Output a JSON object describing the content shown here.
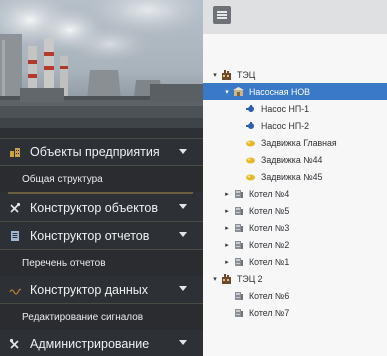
{
  "sidebar": {
    "menu": [
      {
        "label": "Объекты предприятия",
        "icon": "buildings-icon",
        "has_children": true
      },
      {
        "label": "Общая структура",
        "sub": true
      },
      {
        "label": "Конструктор объектов",
        "icon": "tools-icon",
        "has_children": true
      },
      {
        "label": "Конструктор отчетов",
        "icon": "report-icon",
        "has_children": true
      },
      {
        "label": "Перечень отчетов",
        "sub": true
      },
      {
        "label": "Конструктор данных",
        "icon": "data-wave-icon",
        "has_children": true
      },
      {
        "label": "Редактирование сигналов",
        "sub": true
      },
      {
        "label": "Администрирование",
        "icon": "admin-tools-icon",
        "has_children": true
      }
    ]
  },
  "topbar": {
    "menu_icon": "hamburger-icon"
  },
  "tree": {
    "nodes": [
      {
        "label": "ТЭЦ",
        "toggle": "▾",
        "icon": "plant-icon",
        "level": 0
      },
      {
        "label": "Насосная НОВ",
        "toggle": "▾",
        "icon": "pump-station-icon",
        "level": 1,
        "selected": true
      },
      {
        "label": "Насос НП-1",
        "toggle": "",
        "icon": "pump-icon",
        "level": 2
      },
      {
        "label": "Насос НП-2",
        "toggle": "",
        "icon": "pump-icon",
        "level": 2
      },
      {
        "label": "Задвижка Главная",
        "toggle": "",
        "icon": "valve-icon",
        "level": 2
      },
      {
        "label": "Задвижка №44",
        "toggle": "",
        "icon": "valve-icon",
        "level": 2
      },
      {
        "label": "Задвижка №45",
        "toggle": "",
        "icon": "valve-icon",
        "level": 2
      },
      {
        "label": "Котел №4",
        "toggle": "▸",
        "icon": "boiler-icon",
        "level": 1
      },
      {
        "label": "Котел №5",
        "toggle": "▸",
        "icon": "boiler-icon",
        "level": 1
      },
      {
        "label": "Котел №3",
        "toggle": "▸",
        "icon": "boiler-icon",
        "level": 1
      },
      {
        "label": "Котел №2",
        "toggle": "▸",
        "icon": "boiler-icon",
        "level": 1
      },
      {
        "label": "Котел №1",
        "toggle": "▸",
        "icon": "boiler-icon",
        "level": 1
      },
      {
        "label": "ТЭЦ 2",
        "toggle": "▾",
        "icon": "plant-icon",
        "level": 0
      },
      {
        "label": "Котел №6",
        "toggle": "",
        "icon": "boiler-icon",
        "level": 1
      },
      {
        "label": "Котел №7",
        "toggle": "",
        "icon": "boiler-icon",
        "level": 1
      }
    ]
  }
}
